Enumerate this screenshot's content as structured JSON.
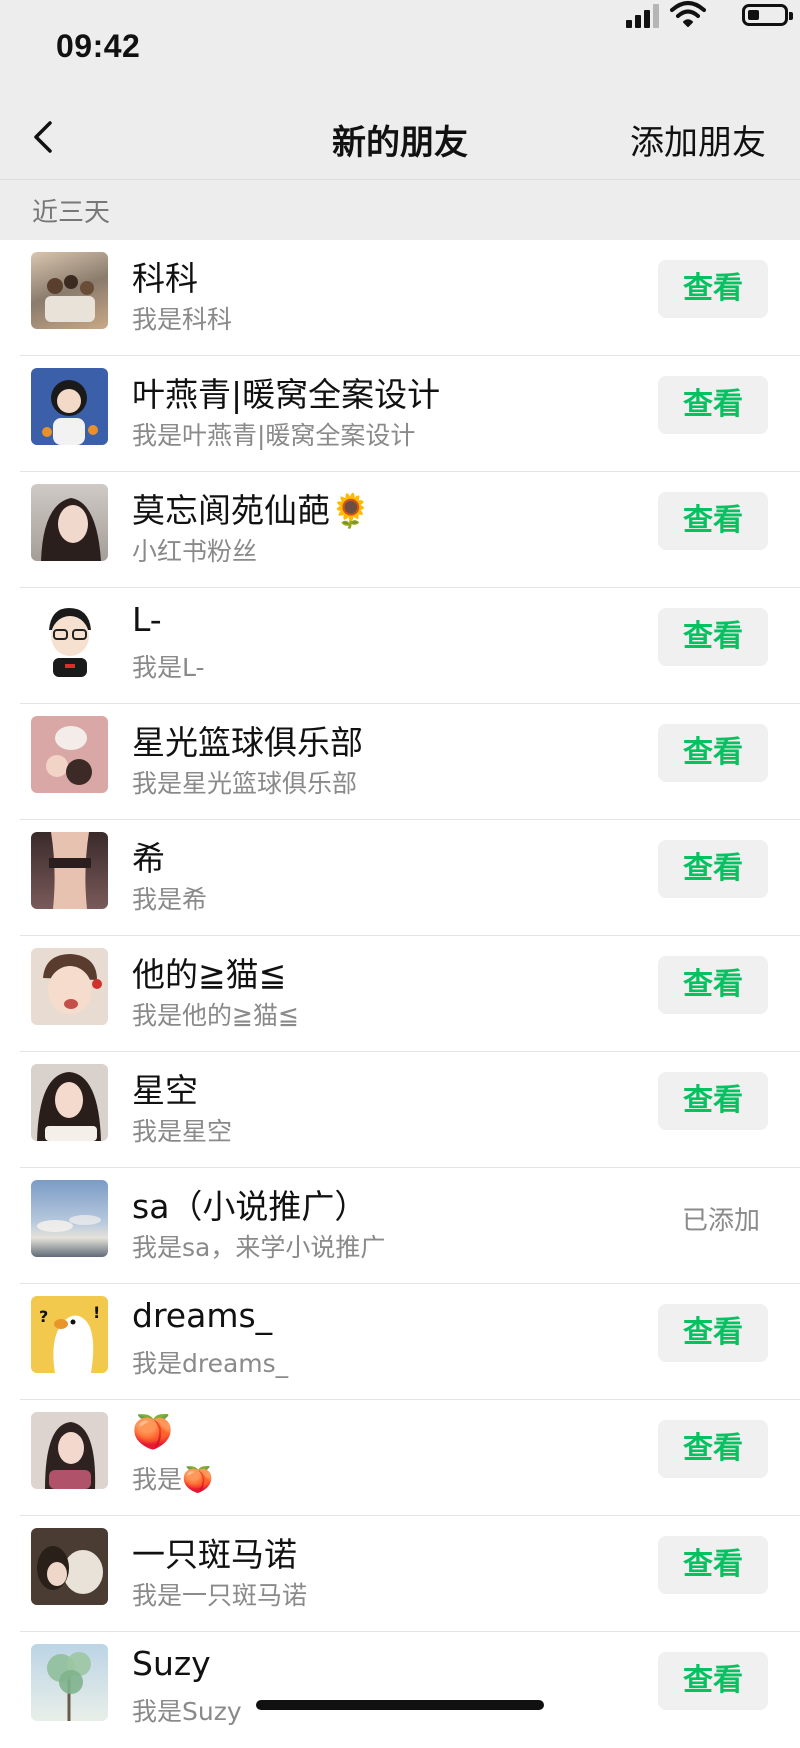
{
  "status_bar": {
    "time": "09:42",
    "icons": [
      "signal-icon",
      "wifi-icon",
      "battery-icon"
    ]
  },
  "nav": {
    "back_icon": "chevron-left-icon",
    "title": "新的朋友",
    "action_label": "添加朋友"
  },
  "section": {
    "label": "近三天"
  },
  "friends": [
    {
      "name": "科科",
      "message": "我是科科",
      "status": "view",
      "button_label": "查看",
      "avatar_color": "#c9a886"
    },
    {
      "name": "叶燕青|暖窝全案设计",
      "message": "我是叶燕青|暖窝全案设计",
      "status": "view",
      "button_label": "查看",
      "avatar_color": "#3b5fa8"
    },
    {
      "name": "莫忘阆苑仙葩🌻",
      "message": "小红书粉丝",
      "status": "view",
      "button_label": "查看",
      "avatar_color": "#b9b2ad"
    },
    {
      "name": "L-",
      "message": "我是L-",
      "status": "view",
      "button_label": "查看",
      "avatar_color": "#ffffff"
    },
    {
      "name": "星光篮球俱乐部",
      "message": "我是星光篮球俱乐部",
      "status": "view",
      "button_label": "查看",
      "avatar_color": "#d9a8a6"
    },
    {
      "name": "希",
      "message": "我是希",
      "status": "view",
      "button_label": "查看",
      "avatar_color": "#6b4b4b"
    },
    {
      "name": "他的≧猫≦",
      "message": "我是他的≧猫≦",
      "status": "view",
      "button_label": "查看",
      "avatar_color": "#e0c4b0"
    },
    {
      "name": "星空",
      "message": "我是星空",
      "status": "view",
      "button_label": "查看",
      "avatar_color": "#4a3a34"
    },
    {
      "name": "sa（小说推广）",
      "message": "我是sa，来学小说推广",
      "status": "added",
      "button_label": "已添加",
      "avatar_color": "#8fa8c8"
    },
    {
      "name": "dreams_",
      "message": "我是dreams_",
      "status": "view",
      "button_label": "查看",
      "avatar_color": "#f2c94c"
    },
    {
      "name": "🍑",
      "message": "我是🍑",
      "status": "view",
      "button_label": "查看",
      "avatar_color": "#c7a9a3"
    },
    {
      "name": "一只斑马诺",
      "message": "我是一只斑马诺",
      "status": "view",
      "button_label": "查看",
      "avatar_color": "#6e5a4c"
    },
    {
      "name": "Suzy",
      "message": "我是Suzy",
      "status": "view",
      "button_label": "查看",
      "avatar_color": "#8fbf9a"
    }
  ],
  "colors": {
    "accent": "#07c160",
    "background": "#ededed",
    "secondary_text": "#8a8a8a"
  }
}
